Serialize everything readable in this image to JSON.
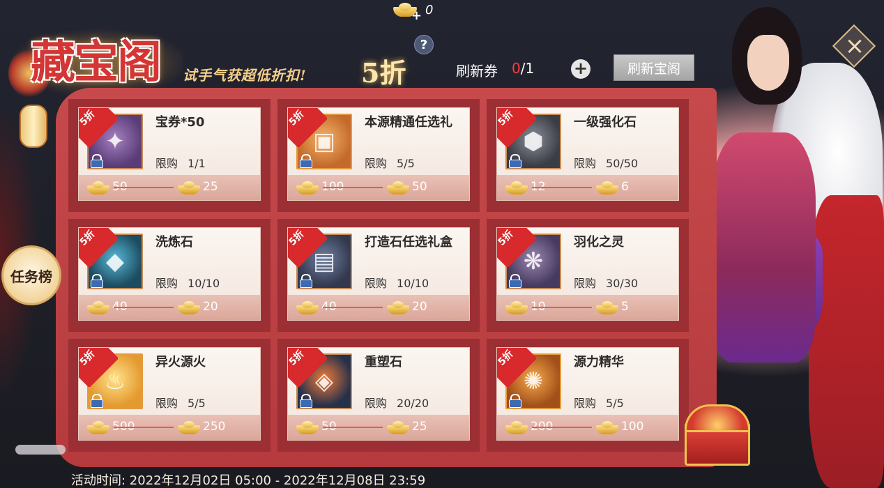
{
  "header": {
    "currency_value": "0",
    "title": "藏宝阁",
    "subtitle": "试手气获超低折扣!",
    "discount": "5折",
    "refresh_label": "刷新券",
    "refresh_used": "0",
    "refresh_total": "/1",
    "refresh_button": "刷新宝阁"
  },
  "side": {
    "task_button": "任务榜"
  },
  "footer": {
    "event_time": "活动时间: 2022年12月02日 05:00 - 2022年12月08日 23:59"
  },
  "items": [
    {
      "name": "宝券*50",
      "ribbon": "5折",
      "limit_label": "限购",
      "limit": "1/1",
      "orig": "50",
      "sale": "25",
      "icon": "ticket-icon"
    },
    {
      "name": "本源精通任选礼",
      "ribbon": "5折",
      "limit_label": "限购",
      "limit": "5/5",
      "orig": "100",
      "sale": "50",
      "icon": "gift-chest-icon"
    },
    {
      "name": "一级强化石",
      "ribbon": "5折",
      "limit_label": "限购",
      "limit": "50/50",
      "orig": "12",
      "sale": "6",
      "icon": "enhance-stone-icon"
    },
    {
      "name": "洗炼石",
      "ribbon": "5折",
      "limit_label": "限购",
      "limit": "10/10",
      "orig": "40",
      "sale": "20",
      "icon": "blue-gem-icon"
    },
    {
      "name": "打造石任选礼盒",
      "ribbon": "5折",
      "limit_label": "限购",
      "limit": "10/10",
      "orig": "40",
      "sale": "20",
      "icon": "silver-chest-icon"
    },
    {
      "name": "羽化之灵",
      "ribbon": "5折",
      "limit_label": "限购",
      "limit": "30/30",
      "orig": "10",
      "sale": "5",
      "icon": "feather-wing-icon"
    },
    {
      "name": "异火源火",
      "ribbon": "5折",
      "limit_label": "限购",
      "limit": "5/5",
      "orig": "500",
      "sale": "250",
      "icon": "flame-icon"
    },
    {
      "name": "重塑石",
      "ribbon": "5折",
      "limit_label": "限购",
      "limit": "20/20",
      "orig": "50",
      "sale": "25",
      "icon": "orange-crystal-icon"
    },
    {
      "name": "源力精华",
      "ribbon": "5折",
      "limit_label": "限购",
      "limit": "5/5",
      "orig": "200",
      "sale": "100",
      "icon": "essence-icon"
    }
  ]
}
